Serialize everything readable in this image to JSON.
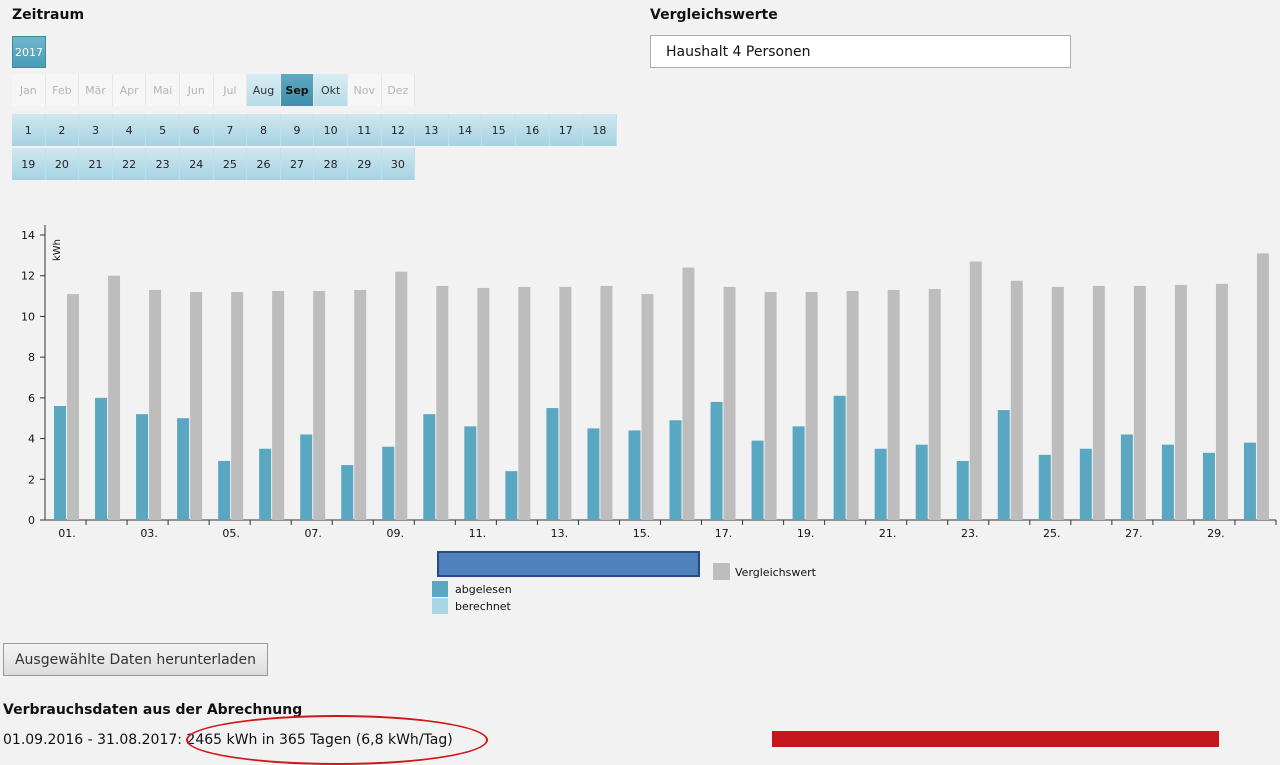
{
  "zeitraum": {
    "title": "Zeitraum",
    "year": "2017"
  },
  "months": [
    {
      "label": "Jan",
      "state": "disabled"
    },
    {
      "label": "Feb",
      "state": "disabled"
    },
    {
      "label": "Mär",
      "state": "disabled"
    },
    {
      "label": "Apr",
      "state": "disabled"
    },
    {
      "label": "Mai",
      "state": "disabled"
    },
    {
      "label": "Jun",
      "state": "disabled"
    },
    {
      "label": "Jul",
      "state": "disabled"
    },
    {
      "label": "Aug",
      "state": "available"
    },
    {
      "label": "Sep",
      "state": "selected"
    },
    {
      "label": "Okt",
      "state": "available"
    },
    {
      "label": "Nov",
      "state": "disabled"
    },
    {
      "label": "Dez",
      "state": "disabled"
    }
  ],
  "days_row1": [
    "1",
    "2",
    "3",
    "4",
    "5",
    "6",
    "7",
    "8",
    "9",
    "10",
    "11",
    "12",
    "13",
    "14",
    "15",
    "16",
    "17",
    "18"
  ],
  "days_row2": [
    "19",
    "20",
    "21",
    "22",
    "23",
    "24",
    "25",
    "26",
    "27",
    "28",
    "29",
    "30"
  ],
  "vergleich": {
    "title": "Vergleichswerte",
    "selected": "Haushalt 4 Personen"
  },
  "chart_data": {
    "type": "bar",
    "ylabel": "kWh",
    "ylim": [
      0,
      14
    ],
    "yticks": [
      "0",
      "2",
      "4",
      "6",
      "8",
      "10",
      "12",
      "14"
    ],
    "xtick_labels": [
      "01.",
      "03.",
      "05.",
      "07.",
      "09.",
      "11.",
      "13.",
      "15.",
      "17.",
      "19.",
      "21.",
      "23.",
      "25.",
      "27.",
      "29."
    ],
    "categories": [
      "1",
      "2",
      "3",
      "4",
      "5",
      "6",
      "7",
      "8",
      "9",
      "10",
      "11",
      "12",
      "13",
      "14",
      "15",
      "16",
      "17",
      "18",
      "19",
      "20",
      "21",
      "22",
      "23",
      "24",
      "25",
      "26",
      "27",
      "28",
      "29",
      "30"
    ],
    "series": [
      {
        "name": "abgelesen",
        "color": "#5aa7c2",
        "values": [
          5.6,
          6.0,
          5.2,
          5.0,
          2.9,
          3.5,
          4.2,
          2.7,
          3.6,
          5.2,
          4.6,
          2.4,
          5.5,
          4.5,
          4.4,
          4.9,
          5.8,
          3.9,
          4.6,
          6.1,
          3.5,
          3.7,
          2.9,
          5.4,
          3.2,
          3.5,
          4.2,
          3.7,
          3.3,
          3.8
        ]
      },
      {
        "name": "Vergleichswert",
        "color": "#bdbdbd",
        "values": [
          11.1,
          12.0,
          11.3,
          11.2,
          11.2,
          11.25,
          11.25,
          11.3,
          12.2,
          11.5,
          11.4,
          11.45,
          11.45,
          11.5,
          11.1,
          12.4,
          11.45,
          11.2,
          11.2,
          11.25,
          11.3,
          11.35,
          12.7,
          11.75,
          11.45,
          11.5,
          11.5,
          11.55,
          11.6,
          13.1
        ]
      }
    ],
    "legend": [
      "abgelesen",
      "berechnet",
      "Vergleichswert"
    ],
    "legend_colors": {
      "abgelesen": "#5aa7c2",
      "berechnet": "#a9d6e5",
      "Vergleichswert": "#bdbdbd"
    }
  },
  "download": {
    "label": "Ausgewählte Daten herunterladen"
  },
  "verbrauch": {
    "title": "Verbrauchsdaten aus der Abrechnung",
    "summary": "01.09.2016 - 31.08.2017: 2465 kWh in 365 Tagen (6,8 kWh/Tag)"
  }
}
